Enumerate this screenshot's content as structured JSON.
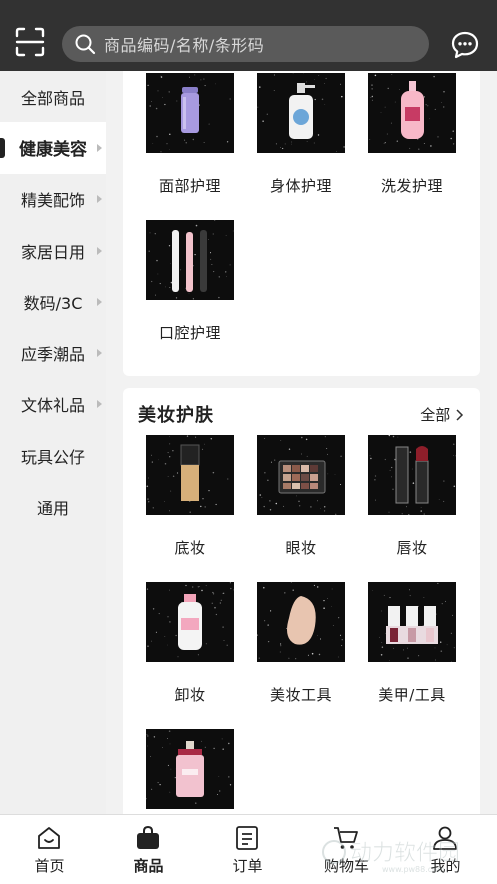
{
  "search": {
    "placeholder": "商品编码/名称/条形码"
  },
  "sidebar": {
    "items": [
      {
        "label": "全部商品",
        "has_arrow": false,
        "active": false
      },
      {
        "label": "健康美容",
        "has_arrow": true,
        "active": true
      },
      {
        "label": "精美配饰",
        "has_arrow": true,
        "active": false
      },
      {
        "label": "家居日用",
        "has_arrow": true,
        "active": false
      },
      {
        "label": "数码/3C",
        "has_arrow": true,
        "active": false
      },
      {
        "label": "应季潮品",
        "has_arrow": true,
        "active": false
      },
      {
        "label": "文体礼品",
        "has_arrow": true,
        "active": false
      },
      {
        "label": "玩具公仔",
        "has_arrow": false,
        "active": false
      },
      {
        "label": "通用",
        "has_arrow": false,
        "active": false
      }
    ]
  },
  "section_personal_care": {
    "items": [
      {
        "label": "面部护理",
        "icon": "face-care-bottle"
      },
      {
        "label": "身体护理",
        "icon": "body-lotion-pump"
      },
      {
        "label": "洗发护理",
        "icon": "shampoo-pump"
      },
      {
        "label": "口腔护理",
        "icon": "electric-toothbrush"
      }
    ]
  },
  "section_makeup": {
    "title": "美妆护肤",
    "all_label": "全部",
    "items": [
      {
        "label": "底妆",
        "icon": "foundation-bottle"
      },
      {
        "label": "眼妆",
        "icon": "eyeshadow-palette"
      },
      {
        "label": "唇妆",
        "icon": "lipstick"
      },
      {
        "label": "卸妆",
        "icon": "micellar-water"
      },
      {
        "label": "美妆工具",
        "icon": "makeup-sponge"
      },
      {
        "label": "美甲/工具",
        "icon": "nail-polish"
      },
      {
        "label": "",
        "icon": "perfume-bottle"
      }
    ]
  },
  "tabbar": {
    "tabs": [
      {
        "label": "首页",
        "icon": "home-icon"
      },
      {
        "label": "商品",
        "icon": "bag-icon",
        "active": true
      },
      {
        "label": "订单",
        "icon": "order-icon"
      },
      {
        "label": "购物车",
        "icon": "cart-icon"
      },
      {
        "label": "我的",
        "icon": "user-icon"
      }
    ]
  },
  "watermark": {
    "text": "动力软件园",
    "subtext": "www.pw88.com"
  },
  "colors": {
    "topbar": "#323232",
    "search_bg": "#5a5a5a",
    "sidebar_bg": "#f0f0f0",
    "active_marker": "#222222"
  }
}
